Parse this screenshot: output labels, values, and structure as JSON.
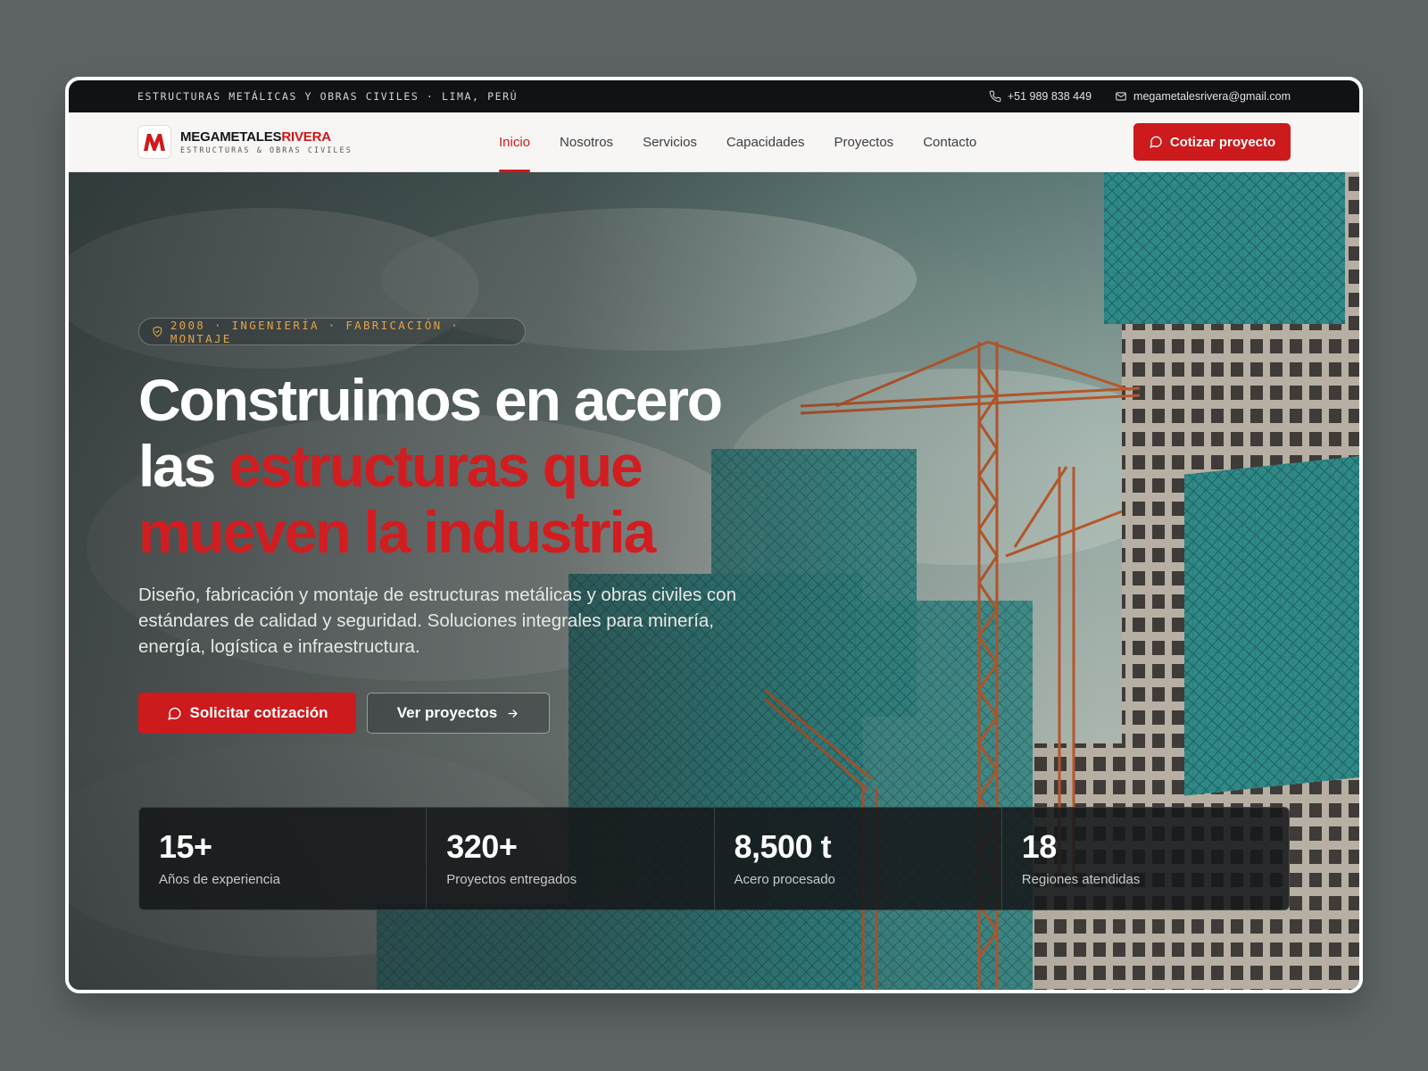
{
  "topbar": {
    "tagline": "ESTRUCTURAS METÁLICAS Y OBRAS CIVILES · LIMA, PERÚ",
    "phone": "+51 989 838 449",
    "email": "megametalesrivera@gmail.com"
  },
  "brand": {
    "name_main": "MEGAMETALES",
    "name_accent": "RIVERA",
    "subtitle": "ESTRUCTURAS & OBRAS CIVILES",
    "logo_letter": "M"
  },
  "nav": {
    "items": [
      {
        "label": "Inicio",
        "active": true
      },
      {
        "label": "Nosotros"
      },
      {
        "label": "Servicios"
      },
      {
        "label": "Capacidades"
      },
      {
        "label": "Proyectos"
      },
      {
        "label": "Contacto"
      }
    ],
    "cta": "Cotizar proyecto"
  },
  "hero": {
    "badge": "2008 · INGENIERÍA · FABRICACIÓN · MONTAJE",
    "headline_line1": "Construimos en acero",
    "headline_line2_white": "las ",
    "headline_line2_red": "estructuras que",
    "headline_line3_red": "mueven la industria",
    "lead": "Diseño, fabricación y montaje de estructuras metálicas y obras civiles con estándares de calidad y seguridad. Soluciones integrales para minería, energía, logística e infraestructura.",
    "primary_button": "Solicitar cotización",
    "secondary_button": "Ver proyectos"
  },
  "stats": [
    {
      "value": "15+",
      "label": "Años de experiencia"
    },
    {
      "value": "320+",
      "label": "Proyectos entregados"
    },
    {
      "value": "8,500 t",
      "label": "Acero procesado"
    },
    {
      "value": "18",
      "label": "Regiones atendidas"
    }
  ],
  "colors": {
    "accent": "#cc1a1d",
    "topbar_bg": "#111214",
    "badge_text": "#e3a447",
    "page_bg": "#5e6464"
  },
  "icons": {
    "phone": "phone-icon",
    "email": "mail-icon",
    "chat": "chat-bubble-icon",
    "arrow": "arrow-right-icon",
    "shield": "shield-icon"
  }
}
